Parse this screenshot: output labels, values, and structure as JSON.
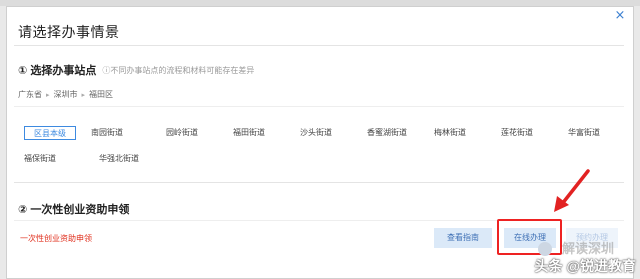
{
  "dialog": {
    "title": "请选择办事情景",
    "close_glyph": "×"
  },
  "section1": {
    "title": "① 选择办事站点",
    "note": "ⓘ不同办事站点的流程和材料可能存在差异"
  },
  "breadcrumb": [
    "广东省",
    "深圳市",
    "福田区"
  ],
  "breadcrumb_sep": "▸",
  "streets": {
    "row1": [
      "区县本级",
      "南园街道",
      "园岭街道",
      "福田街道",
      "沙头街道",
      "香蜜湖街道",
      "梅林街道",
      "莲花街道",
      "华富街道"
    ],
    "row2": [
      "福保街道",
      "华强北街道"
    ],
    "active_index": 0
  },
  "section2": {
    "title": "② 一次性创业资助申领",
    "item_name": "一次性创业资助申领"
  },
  "buttons": {
    "guide": "查看指南",
    "online": "在线办理",
    "appointment": "预约办理"
  },
  "watermark": {
    "top": "解读深圳",
    "bottom": "头条 @锐进教育"
  },
  "colors": {
    "accent": "#3d8ae0",
    "highlight": "#e22222",
    "item_red": "#e0301e"
  }
}
